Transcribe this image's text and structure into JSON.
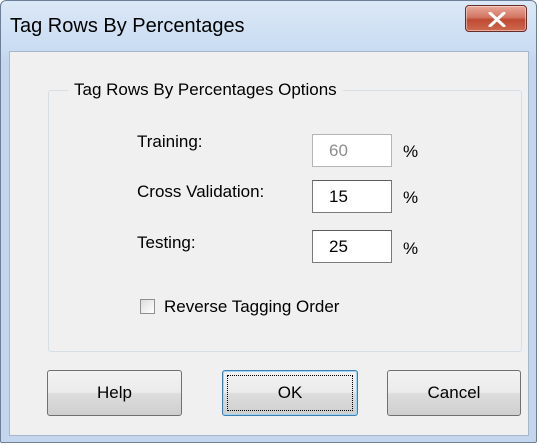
{
  "window": {
    "title": "Tag Rows By Percentages",
    "close_icon": "close-x-icon"
  },
  "options": {
    "group_title": "Tag Rows By Percentages Options",
    "training": {
      "label": "Training:",
      "value": "60",
      "unit": "%",
      "enabled": false
    },
    "cross_validation": {
      "label": "Cross Validation:",
      "value": "15",
      "unit": "%",
      "enabled": true
    },
    "testing": {
      "label": "Testing:",
      "value": "25",
      "unit": "%",
      "enabled": true
    },
    "reverse_order": {
      "label": "Reverse Tagging Order",
      "checked": false
    }
  },
  "buttons": {
    "help": "Help",
    "ok": "OK",
    "cancel": "Cancel"
  }
}
